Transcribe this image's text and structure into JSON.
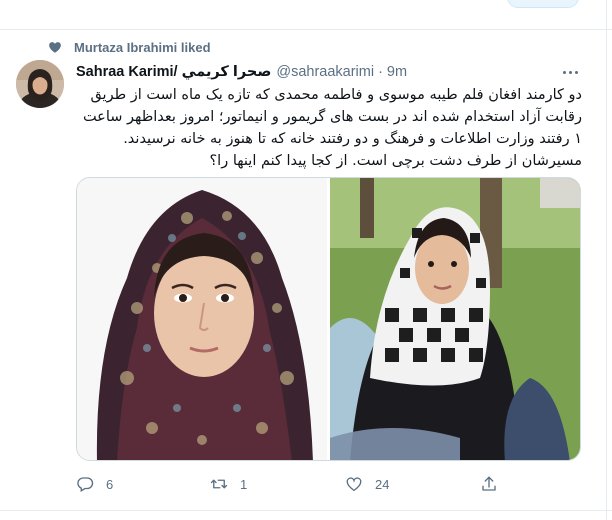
{
  "liked_by": {
    "text": "Murtaza Ibrahimi liked",
    "icon": "heart-icon"
  },
  "tweet": {
    "author": {
      "display_name_latin": "Sahraa Karimi/",
      "display_name_persian": "صحرا كريمي",
      "handle": "@sahraakarimi",
      "separator": "·",
      "time": "9m"
    },
    "text_lines": [
      "دو کارمند افغان فلم طیبه موسوی و فاطمه محمدی که تازه یک ماه است از طریق",
      "رقابت آزاد استخدام شده اند در بست های گریمور و انیماتور؛ امروز بعداظهر ساعت",
      "۱ رفتند وزارت اطلاعات و فرهنگ و  دو رفتند خانه که تا هنوز به خانه نرسیدند.",
      "مسیرشان از طرف دشت برچی است. از کجا پیدا کنم اینها را؟"
    ],
    "media": [
      {
        "description": "portrait-photo-woman-in-patterned-hijab"
      },
      {
        "description": "outdoor-photo-woman-in-black-white-scarf"
      }
    ],
    "actions": {
      "reply": {
        "icon": "reply-icon",
        "count": "6"
      },
      "retweet": {
        "icon": "retweet-icon",
        "count": "1"
      },
      "like": {
        "icon": "like-icon",
        "count": "24"
      },
      "share": {
        "icon": "share-icon",
        "count": ""
      }
    },
    "more_icon": "more-icon"
  },
  "colors": {
    "secondary_text": "#5b7083",
    "border": "#e6ecf0",
    "text": "#0f1419"
  }
}
